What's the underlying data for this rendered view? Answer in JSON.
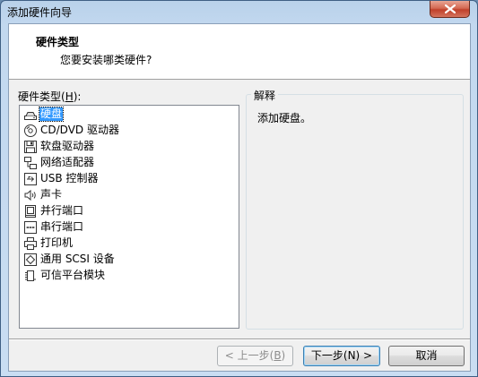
{
  "window": {
    "title": "添加硬件向导"
  },
  "header": {
    "title": "硬件类型",
    "subtitle": "您要安装哪类硬件?"
  },
  "hardware_list": {
    "label_prefix": "硬件类型(",
    "label_hotkey": "H",
    "label_suffix": "):",
    "selected_index": 0,
    "items": [
      {
        "label": "硬盘",
        "icon": "hard-disk-icon"
      },
      {
        "label": "CD/DVD 驱动器",
        "icon": "cd-dvd-icon"
      },
      {
        "label": "软盘驱动器",
        "icon": "floppy-icon"
      },
      {
        "label": "网络适配器",
        "icon": "network-adapter-icon"
      },
      {
        "label": "USB 控制器",
        "icon": "usb-icon"
      },
      {
        "label": "声卡",
        "icon": "speaker-icon"
      },
      {
        "label": "并行端口",
        "icon": "parallel-port-icon"
      },
      {
        "label": "串行端口",
        "icon": "serial-port-icon"
      },
      {
        "label": "打印机",
        "icon": "printer-icon"
      },
      {
        "label": "通用 SCSI 设备",
        "icon": "scsi-icon"
      },
      {
        "label": "可信平台模块",
        "icon": "tpm-icon"
      }
    ]
  },
  "description": {
    "legend": "解释",
    "text": "添加硬盘。"
  },
  "buttons": {
    "back_prefix": "< 上一步(",
    "back_hotkey": "B",
    "back_suffix": ")",
    "next": "下一步(N) >",
    "cancel": "取消"
  }
}
